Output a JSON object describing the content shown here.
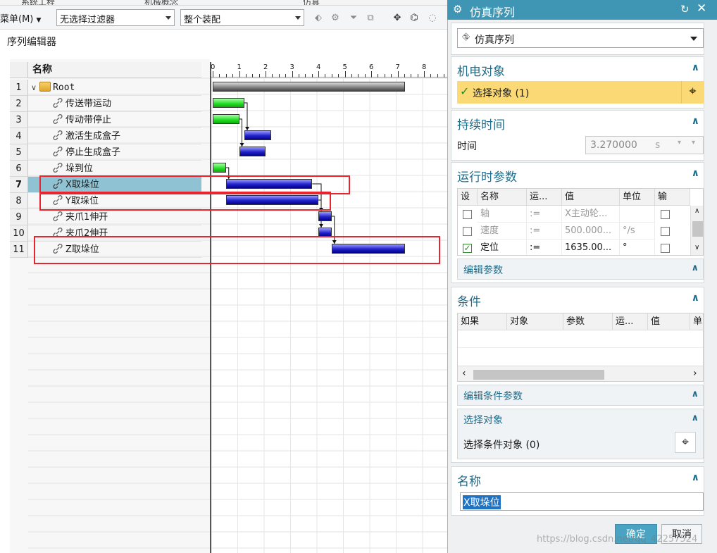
{
  "top_tabs": [
    "系统工程",
    "机械概念",
    "仿真"
  ],
  "toolbar": {
    "menu_label": "菜单(M)",
    "filter_value": "无选择过滤器",
    "assembly_value": "整个装配"
  },
  "editor": {
    "title": "序列编辑器",
    "name_header": "名称",
    "timeline_ticks": [
      "0",
      "1",
      "2",
      "3",
      "4",
      "5",
      "6",
      "7",
      "8"
    ],
    "rows": [
      {
        "num": "1",
        "name": "Root",
        "bold": false
      },
      {
        "num": "2",
        "name": "传送带运动",
        "bold": false
      },
      {
        "num": "3",
        "name": "传动带停止",
        "bold": false
      },
      {
        "num": "4",
        "name": "激活生成盒子",
        "bold": false
      },
      {
        "num": "5",
        "name": "停止生成盒子",
        "bold": false
      },
      {
        "num": "6",
        "name": "垛到位",
        "bold": false
      },
      {
        "num": "7",
        "name": "X取垛位",
        "bold": true
      },
      {
        "num": "8",
        "name": "Y取垛位",
        "bold": false
      },
      {
        "num": "9",
        "name": "夹爪1伸开",
        "bold": false
      },
      {
        "num": "10",
        "name": "夹爪2伸开",
        "bold": false
      },
      {
        "num": "11",
        "name": "Z取垛位",
        "bold": false
      }
    ],
    "bars": [
      {
        "row": 1,
        "start": 0.0,
        "end": 7.27,
        "color": "gray"
      },
      {
        "row": 2,
        "start": 0.0,
        "end": 1.2,
        "color": "green"
      },
      {
        "row": 3,
        "start": 0.0,
        "end": 1.0,
        "color": "green"
      },
      {
        "row": 4,
        "start": 1.2,
        "end": 2.2,
        "color": "blue"
      },
      {
        "row": 5,
        "start": 1.0,
        "end": 2.0,
        "color": "blue"
      },
      {
        "row": 6,
        "start": 0.0,
        "end": 0.5,
        "color": "green"
      },
      {
        "row": 7,
        "start": 0.5,
        "end": 3.77,
        "color": "blue"
      },
      {
        "row": 8,
        "start": 0.5,
        "end": 4.0,
        "color": "blue"
      },
      {
        "row": 9,
        "start": 4.0,
        "end": 4.5,
        "color": "blue"
      },
      {
        "row": 10,
        "start": 4.0,
        "end": 4.5,
        "color": "blue"
      },
      {
        "row": 11,
        "start": 4.5,
        "end": 7.27,
        "color": "blue"
      }
    ]
  },
  "dialog": {
    "title": "仿真序列",
    "type_value": "仿真序列",
    "mechatronic": {
      "header": "机电对象",
      "select_label": "选择对象 (1)"
    },
    "duration": {
      "header": "持续时间",
      "time_label": "时间",
      "time_value": "3.270000",
      "unit": "s"
    },
    "runtime": {
      "header": "运行时参数",
      "columns": [
        "设",
        "名称",
        "运...",
        "值",
        "单位",
        "输"
      ],
      "rows": [
        {
          "name": "轴",
          "op": ":=",
          "value": "X主动轮...",
          "unit": "",
          "checked": false,
          "dim": true
        },
        {
          "name": "速度",
          "op": ":=",
          "value": "500.000...",
          "unit": "°/s",
          "checked": false,
          "dim": true
        },
        {
          "name": "定位",
          "op": ":=",
          "value": "1635.00...",
          "unit": "°",
          "checked": true,
          "dim": false
        }
      ],
      "edit_params": "编辑参数"
    },
    "conditions": {
      "header": "条件",
      "columns": [
        "如果",
        "对象",
        "参数",
        "运...",
        "值",
        "单"
      ],
      "edit_condition_params": "编辑条件参数",
      "select_object_header": "选择对象",
      "select_condition_label": "选择条件对象 (0)"
    },
    "name_section": {
      "header": "名称",
      "value": "X取垛位"
    },
    "ok_label": "确定",
    "cancel_label": "取消"
  },
  "watermark": "https://blog.csdn.net/qq_42257524",
  "colors": {
    "dialog_header": "#3e96b4",
    "section_title": "#1e6c8a",
    "highlight_yellow": "#fbd974",
    "selected_row": "#8fc3d3",
    "annotation_red": "#e8242e"
  }
}
